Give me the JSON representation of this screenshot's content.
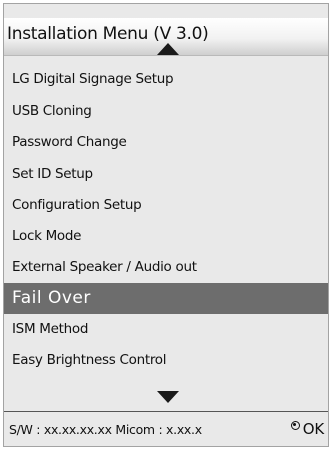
{
  "menu": {
    "title": "Installation Menu (V 3.0)",
    "items": [
      {
        "label": "LG Digital Signage Setup"
      },
      {
        "label": "USB Cloning"
      },
      {
        "label": "Password Change"
      },
      {
        "label": "Set ID Setup"
      },
      {
        "label": "Configuration Setup"
      },
      {
        "label": "Lock Mode"
      },
      {
        "label": "External Speaker / Audio out"
      },
      {
        "label": "Fail Over"
      },
      {
        "label": "ISM Method"
      },
      {
        "label": "Easy Brightness Control"
      }
    ],
    "selected_item": "Fail Over",
    "scroll_up_icon": "triangle-up-icon",
    "scroll_down_icon": "triangle-down-icon"
  },
  "footer": {
    "version_info": "S/W : xx.xx.xx.xx Micom : x.xx.x",
    "ok_icon": "remote-ok-button-icon",
    "ok_label": "OK"
  },
  "colors": {
    "panel_background": "#e9e9e9",
    "selected_background": "#6d6d6d",
    "selected_text": "#ffffff",
    "text": "#111111"
  }
}
